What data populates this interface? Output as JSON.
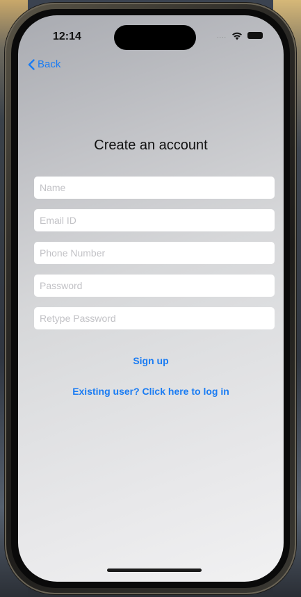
{
  "status_bar": {
    "time": "12:14",
    "signal": "....",
    "wifi_icon": "wifi-icon",
    "battery_icon": "battery-icon"
  },
  "nav": {
    "back_label": "Back",
    "back_icon": "chevron-left-icon"
  },
  "form": {
    "title": "Create an account",
    "fields": [
      {
        "placeholder": "Name",
        "value": ""
      },
      {
        "placeholder": "Email ID",
        "value": ""
      },
      {
        "placeholder": "Phone Number",
        "value": ""
      },
      {
        "placeholder": "Password",
        "value": ""
      },
      {
        "placeholder": "Retype Password",
        "value": ""
      }
    ],
    "signup_label": "Sign up",
    "login_link_label": "Existing user? Click here to log in"
  },
  "colors": {
    "accent": "#1a7cf3"
  }
}
